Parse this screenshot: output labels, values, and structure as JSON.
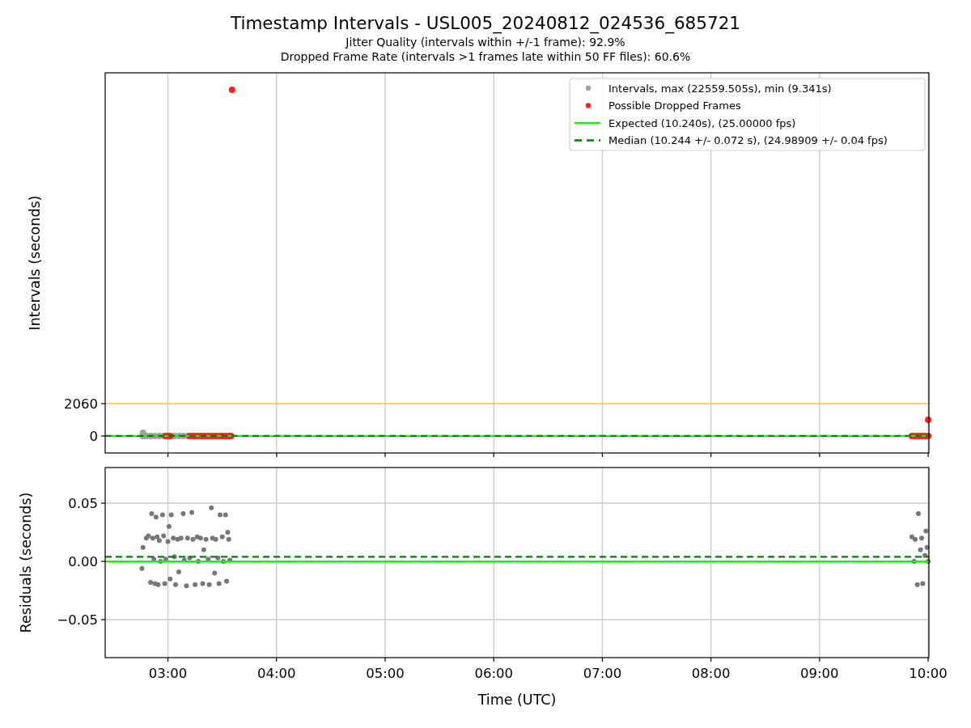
{
  "figure": {
    "title": "Timestamp Intervals - USL005_20240812_024536_685721",
    "subtitles": [
      "Jitter Quality (intervals within +/-1 frame): 92.9%",
      "Dropped Frame Rate (intervals >1 frames late within 50 FF files): 60.6%"
    ]
  },
  "top_chart": {
    "chart_data": {
      "type": "scatter",
      "ylabel": "Intervals (seconds)",
      "grid": "x",
      "legend": "upper right",
      "xlim": [
        2.422,
        10.007
      ],
      "ylim": [
        -1082,
        23124
      ],
      "yticks": [
        {
          "value": 0,
          "label": "0"
        },
        {
          "value": 2060,
          "label": "2060"
        }
      ],
      "series": [
        {
          "name": "Intervals, max (22559.505s), min (9.341s)",
          "color": "#a0a0a0",
          "x": [
            2.77,
            2.77,
            2.8,
            2.84,
            2.88,
            2.92,
            2.96,
            3.06,
            3.1,
            3.14,
            3.18
          ],
          "values": [
            200,
            0,
            0,
            0,
            0,
            0,
            0,
            0,
            0,
            0,
            0
          ]
        },
        {
          "name": "Possible Dropped Frames",
          "color": "#ff2020",
          "x": [
            2.98,
            3.0,
            3.02,
            3.2,
            3.23,
            3.26,
            3.29,
            3.32,
            3.35,
            3.38,
            3.41,
            3.44,
            3.47,
            3.5,
            3.53,
            3.56,
            3.58,
            3.59,
            9.85,
            9.88,
            9.91,
            9.94,
            9.97,
            10.0,
            10.0
          ],
          "values": [
            0,
            0,
            0,
            0,
            0,
            0,
            0,
            0,
            0,
            0,
            0,
            0,
            0,
            0,
            0,
            0,
            0,
            22040,
            0,
            0,
            0,
            0,
            0,
            0,
            1030
          ]
        }
      ],
      "ref_lines": [
        {
          "axis": "y",
          "value": 0,
          "label": "Expected (10.240s), (25.00000 fps)",
          "color": "#00ff00"
        },
        {
          "axis": "y",
          "value": 4,
          "label": "Median (10.244 +/- 0.072 s), (24.98909 +/- 0.04 fps)",
          "color": "#008000"
        },
        {
          "axis": "y",
          "value": 2060,
          "color": "#ffc040"
        }
      ]
    }
  },
  "bottom_chart": {
    "chart_data": {
      "type": "scatter",
      "xlabel": "Time (UTC)",
      "ylabel": "Residuals (seconds)",
      "grid": "both",
      "xlim": [
        2.422,
        10.007
      ],
      "ylim": [
        -0.0826,
        0.0806
      ],
      "xticks": [
        {
          "value": 3,
          "label": "03:00"
        },
        {
          "value": 4,
          "label": "04:00"
        },
        {
          "value": 5,
          "label": "05:00"
        },
        {
          "value": 6,
          "label": "06:00"
        },
        {
          "value": 7,
          "label": "07:00"
        },
        {
          "value": 8,
          "label": "08:00"
        },
        {
          "value": 9,
          "label": "09:00"
        },
        {
          "value": 10,
          "label": "10:00"
        }
      ],
      "yticks": [
        {
          "value": -0.05,
          "label": "−0.05"
        },
        {
          "value": 0,
          "label": "0.00"
        },
        {
          "value": 0.05,
          "label": "0.05"
        }
      ],
      "series": [
        {
          "color": "#777777",
          "x": [
            2.76,
            2.77,
            2.8,
            2.82,
            2.84,
            2.85,
            2.86,
            2.87,
            2.88,
            2.89,
            2.9,
            2.91,
            2.92,
            2.93,
            2.95,
            2.96,
            2.97,
            2.98,
            3.0,
            3.01,
            3.02,
            3.03,
            3.05,
            3.06,
            3.07,
            3.09,
            3.1,
            3.12,
            3.14,
            3.15,
            3.17,
            3.18,
            3.2,
            3.22,
            3.23,
            3.25,
            3.27,
            3.28,
            3.3,
            3.32,
            3.33,
            3.35,
            3.37,
            3.38,
            3.4,
            3.41,
            3.43,
            3.44,
            3.46,
            3.47,
            3.48,
            3.5,
            3.51,
            3.53,
            3.54,
            3.55,
            3.56,
            3.57,
            9.85,
            9.87,
            9.88,
            9.9,
            9.91,
            9.93,
            9.94,
            9.95,
            9.97,
            9.98,
            9.99,
            10.0
          ],
          "values": [
            -0.006,
            0.012,
            0.02,
            0.022,
            -0.018,
            0.041,
            0.02,
            0.002,
            -0.019,
            0.038,
            0.021,
            -0.02,
            0.018,
            0.0,
            0.04,
            0.022,
            -0.019,
            0.002,
            0.017,
            0.03,
            -0.015,
            0.04,
            0.02,
            0.004,
            -0.02,
            0.019,
            -0.009,
            0.02,
            0.041,
            0.001,
            -0.021,
            0.02,
            0.003,
            0.042,
            0.019,
            -0.02,
            0.021,
            0.0,
            0.02,
            -0.019,
            0.01,
            0.019,
            0.002,
            -0.02,
            0.046,
            0.02,
            -0.01,
            0.019,
            0.003,
            -0.019,
            0.04,
            0.021,
            0.0,
            0.04,
            -0.017,
            0.025,
            0.019,
            0.001,
            0.021,
            0.0,
            0.019,
            -0.02,
            0.041,
            0.01,
            0.02,
            -0.019,
            0.005,
            0.026,
            0.012,
            0.0
          ]
        }
      ],
      "ref_lines": [
        {
          "axis": "y",
          "value": 0,
          "color": "#00ff00"
        },
        {
          "axis": "y",
          "value": 0.004,
          "color": "#008000"
        }
      ]
    }
  }
}
